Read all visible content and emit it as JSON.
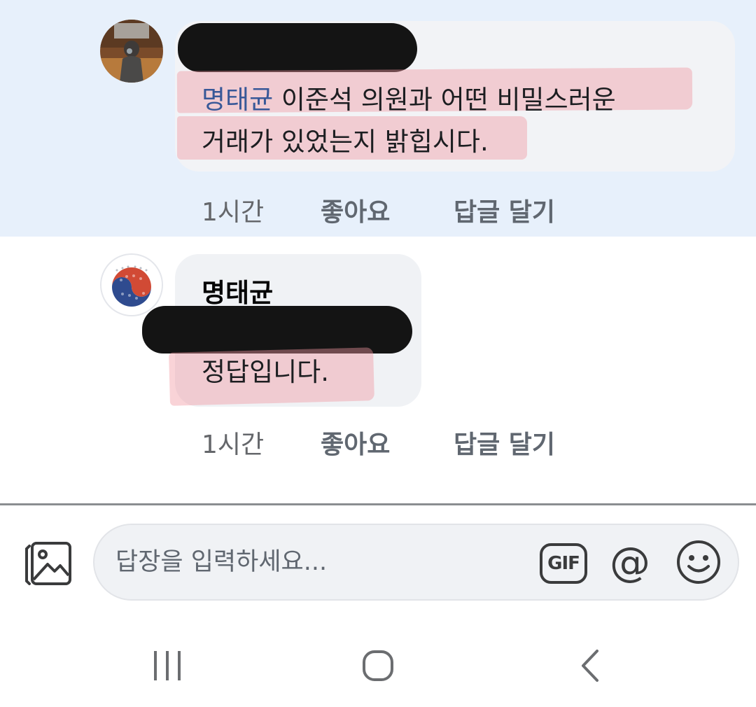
{
  "comment": {
    "mention": "명태균",
    "line1_rest": " 이준석 의원과 어떤 비밀스러운",
    "line2": "거래가 있었는지 밝힙시다.",
    "time": "1시간",
    "like_label": "좋아요",
    "reply_label": "답글 달기"
  },
  "reply": {
    "author": "명태균",
    "text": "정답입니다.",
    "time": "1시간",
    "like_label": "좋아요",
    "reply_label": "답글 달기"
  },
  "composer": {
    "placeholder": "답장을 입력하세요...",
    "gif_label": "GIF",
    "at_label": "@",
    "icons": [
      "photo-icon",
      "gif-icon",
      "at-icon",
      "emoji-icon"
    ]
  },
  "navbar": {
    "icons": [
      "recent-apps-icon",
      "home-icon",
      "back-icon"
    ]
  },
  "colors": {
    "highlight_background": "#e7f0fb",
    "mention": "#385898",
    "annotation_highlight": "#f096a0",
    "redaction": "#141414"
  }
}
